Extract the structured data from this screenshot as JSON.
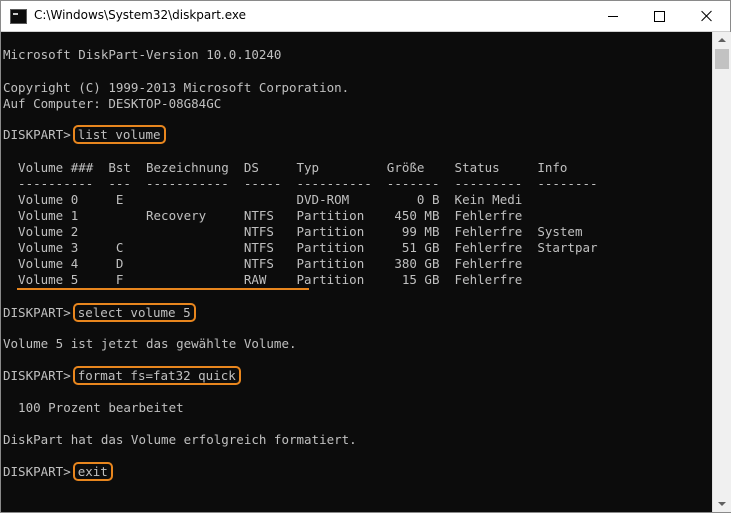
{
  "window": {
    "title": "C:\\Windows\\System32\\diskpart.exe",
    "app_icon": "console-icon",
    "controls": [
      "minimize-icon",
      "maximize-icon",
      "close-icon"
    ]
  },
  "colors": {
    "console_background": "#0c0c0c",
    "console_text": "#c0c0c0",
    "highlight": "#e8861e",
    "titlebar": "#ffffff"
  },
  "console": {
    "version": "Microsoft DiskPart-Version 10.0.10240",
    "copyright": "Copyright (C) 1999-2013 Microsoft Corporation.",
    "computer": "Auf Computer: DESKTOP-08G84GC",
    "prompt": "DISKPART>",
    "commands": [
      "list volume",
      "select volume 5",
      "format fs=fat32 quick",
      "exit"
    ],
    "table": {
      "header": "  Volume ###  Bst  Bezeichnung  DS     Typ         Größe    Status     Info",
      "separator": "  ----------  ---  -----------  -----  ----------  -------  ---------  --------",
      "rows": [
        "  Volume 0     E                       DVD-ROM         0 B  Kein Medi",
        "  Volume 1         Recovery     NTFS   Partition    450 MB  Fehlerfre",
        "  Volume 2                      NTFS   Partition     99 MB  Fehlerfre  System",
        "  Volume 3     C                NTFS   Partition     51 GB  Fehlerfre  Startpar",
        "  Volume 4     D                NTFS   Partition    380 GB  Fehlerfre",
        "  Volume 5     F                RAW    Partition     15 GB  Fehlerfre"
      ]
    },
    "select_result": "Volume 5 ist jetzt das gewählte Volume.",
    "format_progress": "  100 Prozent bearbeitet",
    "format_result": "DiskPart hat das Volume erfolgreich formatiert."
  }
}
